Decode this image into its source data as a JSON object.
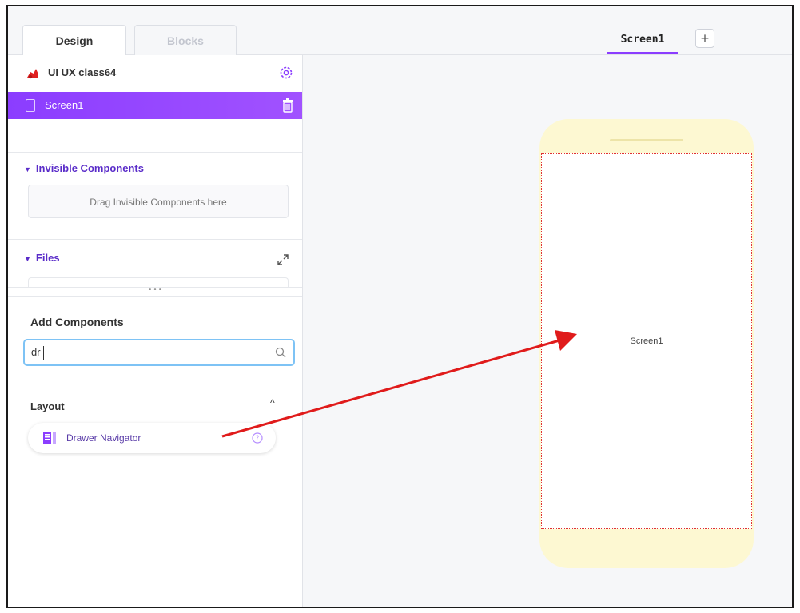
{
  "tabs": {
    "design_label": "Design",
    "blocks_label": "Blocks"
  },
  "screen_tab": {
    "label": "Screen1",
    "add_label": "+"
  },
  "project": {
    "name": "UI UX class64",
    "icon": "project-logo-icon"
  },
  "screen_row": {
    "label": "Screen1"
  },
  "invisible_components": {
    "title": "Invisible Components",
    "placeholder": "Drag Invisible Components here"
  },
  "files": {
    "title": "Files",
    "handle": "• • •"
  },
  "add_components": {
    "title": "Add Components",
    "search_value": "dr"
  },
  "layout_section": {
    "title": "Layout",
    "chevron": "^",
    "items": [
      {
        "label": "Drawer Navigator"
      }
    ]
  },
  "canvas": {
    "screen_label": "Screen1"
  },
  "colors": {
    "accent": "#8b3dff",
    "phone_body": "#fdf8d2",
    "annotation_arrow": "#e01b1b"
  }
}
